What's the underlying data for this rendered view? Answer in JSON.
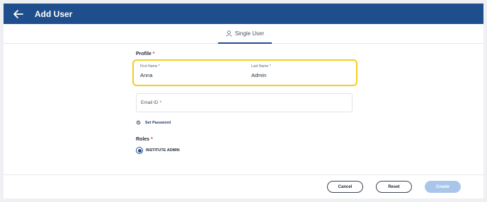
{
  "header": {
    "title": "Add User",
    "back_icon": "arrow-left-icon"
  },
  "tabs": [
    {
      "label": "Single User",
      "icon": "user-icon",
      "active": true
    }
  ],
  "profile": {
    "section_label": "Profile",
    "required_mark": "*",
    "first_name": {
      "label": "First Name *",
      "value": "Anna"
    },
    "last_name": {
      "label": "Last Name *",
      "value": "Admin"
    },
    "email": {
      "label": "Email ID",
      "required_mark": "*",
      "value": ""
    },
    "set_password": {
      "label": "Set Password",
      "icon": "check-circle-icon"
    }
  },
  "roles": {
    "section_label": "Roles",
    "required_mark": "*",
    "options": [
      {
        "label": "INSTITUTE ADMIN",
        "selected": true
      }
    ]
  },
  "footer": {
    "cancel_label": "Cancel",
    "reset_label": "Reset",
    "create_label": "Create"
  },
  "colors": {
    "header_bg": "#1f4e8c",
    "highlight_border": "#f2cf1e",
    "required": "#d0342c",
    "create_disabled": "#a9c6ea"
  }
}
